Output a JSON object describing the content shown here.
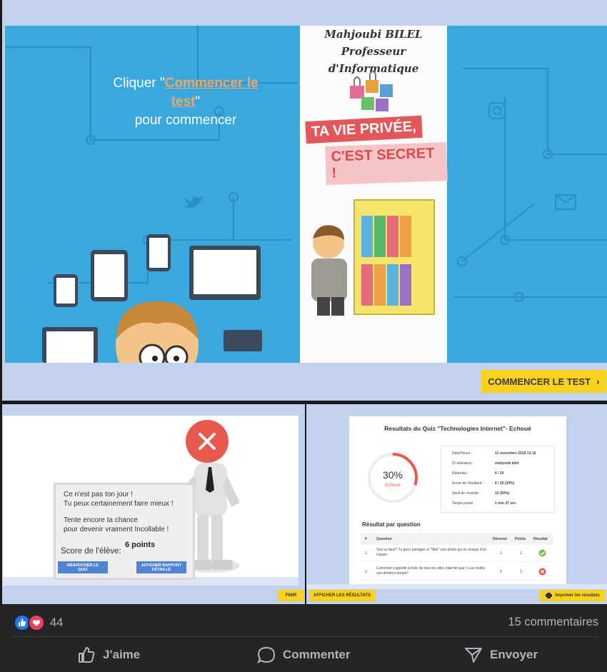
{
  "slide": {
    "instruction_prefix": "Cliquer \"",
    "instruction_link": "Commencer le test",
    "instruction_suffix": "\"",
    "instruction_line3": "pour commencer",
    "poster_title_line1": "Mahjoubi BILEL Professeur",
    "poster_title_line2": "d'Informatique",
    "poster_stamp1": "TA VIE PRIVÉE,",
    "poster_stamp2": "C'EST SECRET !",
    "start_button": "COMMENCER LE TEST"
  },
  "fail_panel": {
    "message_line1": "Ce n'est pas ton jour !",
    "message_line2": "Tu peux certainement faire mieux !",
    "message_line3": "Tente encore ta chance",
    "message_line4": "pour devenir vraiment Incollable !",
    "score_label": "Score de l'élève:",
    "score_value": "6 points",
    "btn_show_quiz": "RÉAFFICHER LE QUIZ",
    "btn_report": "AFFICHER RAPPORT DÉTAILLÉ",
    "btn_finish": "FINIR"
  },
  "results_panel": {
    "title": "Resultats du Quiz \"Technologies Internet\"- Echoué",
    "percent": "30%",
    "status": "Echoué",
    "percent_value": 0.3,
    "details": [
      {
        "label": "Date/Heure :",
        "value": "12 novembre 2018 13:16"
      },
      {
        "label": "ID utilisateur :",
        "value": "mahjoubi bilel"
      },
      {
        "label": "Répondu :",
        "value": "6 / 20"
      },
      {
        "label": "Score de l'étudiant :",
        "value": "6 / 20 (30%)"
      },
      {
        "label": "Seuil de réussite :",
        "value": "10 (50%)"
      },
      {
        "label": "Temps passé :",
        "value": "1 min 37 sec"
      }
    ],
    "per_question_title": "Résultat par question",
    "columns": [
      "#",
      "Question",
      "Décerné",
      "Points",
      "Résultat"
    ],
    "rows": [
      {
        "num": "1.",
        "question": "Vrai ou faux? Tu peux partager or \"liker\" une photo qui se moque d'un copain.",
        "awarded": "1",
        "points": "1",
        "result": "correct"
      },
      {
        "num": "2.",
        "question": "Comment s'appelle la liste de tous les sites Internet que t u as visités ces derniers temps?",
        "awarded": "0",
        "points": "1",
        "result": "incorrect"
      }
    ],
    "btn_show_results": "AFFICHER LES RÉSULTATS",
    "btn_print": "Imprimer les résultats"
  },
  "social": {
    "reaction_count": "44",
    "comments": "15 commentaires",
    "like": "J'aime",
    "comment": "Commenter",
    "share": "Envoyer"
  },
  "colors": {
    "slide_blue": "#39a8df",
    "accent_yellow": "#fad21d",
    "fail_red": "#e8584c",
    "link_orange": "#f3a462",
    "fb_bg": "#242526"
  }
}
